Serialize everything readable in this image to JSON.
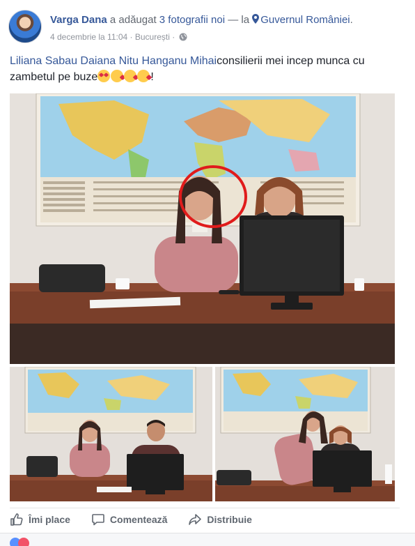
{
  "post": {
    "author": "Varga Dana",
    "action_text": " a adăugat ",
    "action_link": "3 fotografii noi",
    "separator": " — la ",
    "location": "Guvernul României",
    "location_suffix": ".",
    "date": "4 decembrie la 11:04",
    "place": "București",
    "dot": " · ",
    "tags": [
      "Liliana Sabau",
      "Daiana Nitu",
      "Hanganu Mihai"
    ],
    "message_text": "consilierii mei incep munca cu zambetul pe buze",
    "message_end": "!",
    "emojis": [
      "heart-eyes-emoji",
      "kiss-emoji",
      "kiss-emoji",
      "kiss-emoji"
    ]
  },
  "photos": {
    "count": 3
  },
  "actions": {
    "like": "Îmi place",
    "comment": "Comentează",
    "share": "Distribuie"
  },
  "colors": {
    "link": "#365899",
    "meta": "#90949c",
    "action": "#606770",
    "highlight_circle": "#e01b1b"
  }
}
